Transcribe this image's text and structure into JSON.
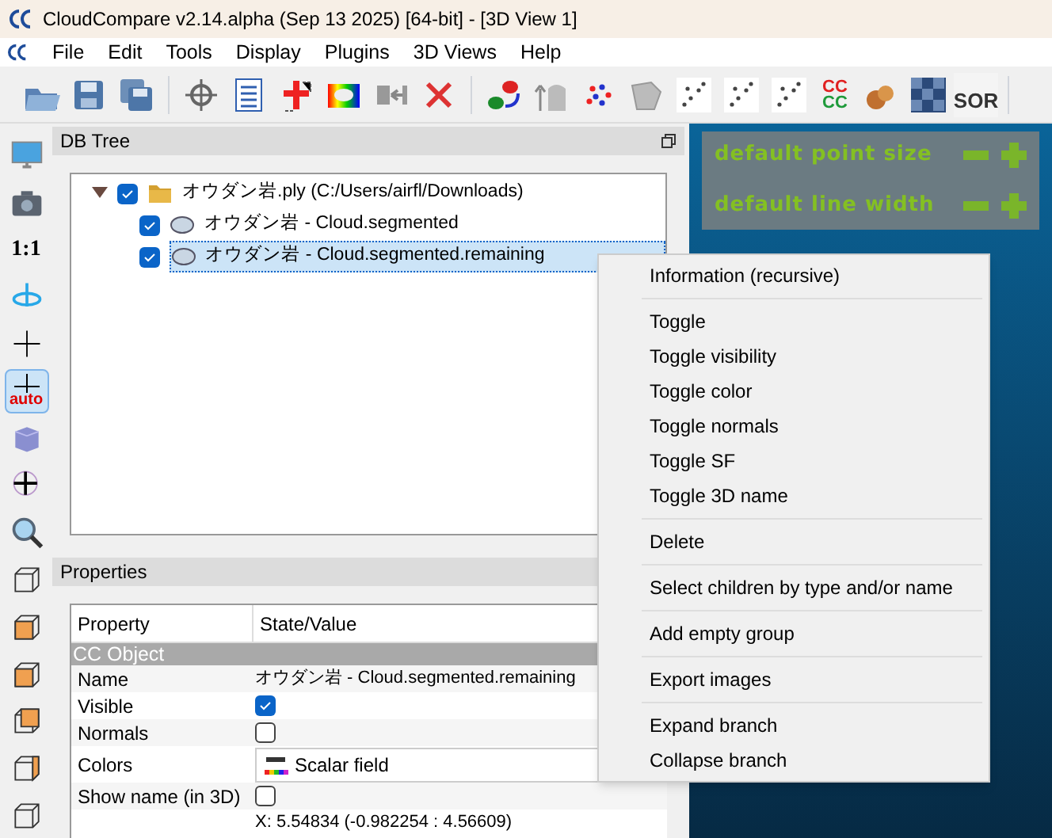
{
  "window": {
    "title": "CloudCompare v2.14.alpha (Sep 13 2025) [64-bit] - [3D View 1]"
  },
  "menu_bar": [
    "File",
    "Edit",
    "Tools",
    "Display",
    "Plugins",
    "3D Views",
    "Help"
  ],
  "toolbar": [
    {
      "kind": "open"
    },
    {
      "kind": "save"
    },
    {
      "kind": "saveall"
    },
    {
      "kind": "sep"
    },
    {
      "kind": "pick"
    },
    {
      "kind": "list"
    },
    {
      "kind": "cross"
    },
    {
      "kind": "rainbow"
    },
    {
      "kind": "merge"
    },
    {
      "kind": "delete"
    },
    {
      "kind": "sep"
    },
    {
      "kind": "swap"
    },
    {
      "kind": "hand"
    },
    {
      "kind": "dots"
    },
    {
      "kind": "mesh"
    },
    {
      "kind": "scatter"
    },
    {
      "kind": "scatter"
    },
    {
      "kind": "scatter"
    },
    {
      "kind": "cccc",
      "lines": [
        "CC",
        "CC"
      ]
    },
    {
      "kind": "bags"
    },
    {
      "kind": "checker"
    },
    {
      "kind": "sor",
      "text": "SOR"
    },
    {
      "kind": "sep"
    }
  ],
  "left_toolbar": [
    {
      "kind": "screen",
      "selected": false
    },
    {
      "kind": "camera",
      "selected": false
    },
    {
      "kind": "text",
      "text": "1:1",
      "selected": false
    },
    {
      "kind": "rotate",
      "selected": false
    },
    {
      "kind": "plus",
      "selected": false
    },
    {
      "kind": "auto",
      "text": "auto",
      "selected": true
    },
    {
      "kind": "cube",
      "selected": false
    },
    {
      "kind": "move",
      "selected": false
    },
    {
      "kind": "zoom",
      "selected": false
    },
    {
      "kind": "box0",
      "selected": false
    },
    {
      "kind": "box1",
      "selected": false
    },
    {
      "kind": "box2",
      "selected": false
    },
    {
      "kind": "box3",
      "selected": false
    },
    {
      "kind": "box4",
      "selected": false
    },
    {
      "kind": "box0",
      "selected": false
    }
  ],
  "db_tree": {
    "title": "DB Tree",
    "items": [
      {
        "label": "オウダン岩.ply (C:/Users/airfl/Downloads)",
        "checked": true,
        "expanded": true,
        "selected": false,
        "kind": "folder",
        "children": [
          {
            "label": "オウダン岩 - Cloud.segmented",
            "checked": true,
            "selected": false,
            "kind": "cloud"
          },
          {
            "label": "オウダン岩 - Cloud.segmented.remaining",
            "checked": true,
            "selected": true,
            "kind": "cloud"
          }
        ]
      }
    ]
  },
  "properties": {
    "title": "Properties",
    "columns": [
      "Property",
      "State/Value"
    ],
    "rows": [
      {
        "kind": "section",
        "label": "CC Object"
      },
      {
        "kind": "text",
        "property": "Name",
        "value": "オウダン岩 - Cloud.segmented.remaining"
      },
      {
        "kind": "checkbox",
        "property": "Visible",
        "checked": true
      },
      {
        "kind": "checkbox",
        "property": "Normals",
        "checked": false
      },
      {
        "kind": "combo",
        "property": "Colors",
        "value": "Scalar field"
      },
      {
        "kind": "checkbox",
        "property": "Show name (in 3D)",
        "checked": false
      },
      {
        "kind": "text",
        "value": "X: 5.54834 (-0.982254 : 4.56609)"
      }
    ]
  },
  "view_overlay": [
    "default point size",
    "default line width"
  ],
  "context_menu": [
    [
      "Information (recursive)"
    ],
    [
      "Toggle",
      "Toggle visibility",
      "Toggle color",
      "Toggle normals",
      "Toggle SF",
      "Toggle 3D name"
    ],
    [
      "Delete"
    ],
    [
      "Select children by type and/or name"
    ],
    [
      "Add empty group"
    ],
    [
      "Export images"
    ],
    [
      "Expand branch",
      "Collapse branch"
    ]
  ]
}
